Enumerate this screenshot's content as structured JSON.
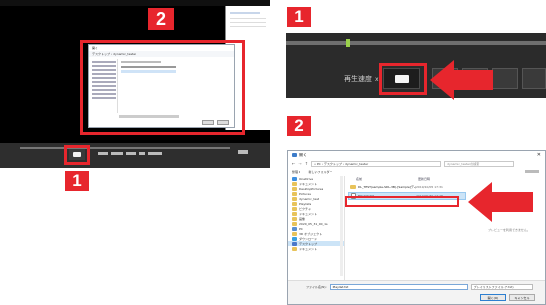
{
  "badges": {
    "left_top": "2",
    "left_bottom": "1",
    "right_top": "1",
    "right_mid": "2"
  },
  "player": {
    "window_title": "",
    "repeat_label": "再生速度",
    "repeat_value": "x1",
    "dialog_title": "開く",
    "breadcrumb": "デスクトップ › dynamic_tester"
  },
  "large_dialog": {
    "title": "開く",
    "address": "« PC › デスクトップ › dynamic_tester",
    "search_placeholder": "dynamic_testerの検索",
    "toolbar": {
      "organize": "整理 ▾",
      "new_folder": "新しいフォルダー"
    },
    "columns": {
      "name": "名前",
      "date": "更新日時"
    },
    "files": [
      {
        "name": "DL_TEST(sample-SDL-3B)-[Sample]ディレクトリ",
        "date": "2019/10/05 17:31",
        "selected": false,
        "kind": "folder"
      },
      {
        "name": "Playlist.txt",
        "date": "2019/09/30 17:28",
        "selected": true,
        "kind": "file"
      }
    ],
    "preview_text": "プレビューを利用できません。",
    "nav_items": [
      {
        "label": "OneDrive",
        "kind": "cloud"
      },
      {
        "label": "ドキュメント",
        "kind": "folder"
      },
      {
        "label": "DesktopPictures",
        "kind": "folder"
      },
      {
        "label": "Pictures",
        "kind": "folder"
      },
      {
        "label": "dynamic_test",
        "kind": "folder"
      },
      {
        "label": "Playlists",
        "kind": "folder"
      },
      {
        "label": "ピクチャ",
        "kind": "folder"
      },
      {
        "label": "ドキュメント",
        "kind": "folder"
      },
      {
        "label": "画像",
        "kind": "folder"
      },
      {
        "label": "2020_05_31_00_1s",
        "kind": "folder"
      },
      {
        "label": "PC",
        "kind": "pc"
      },
      {
        "label": "3D オブジェクト",
        "kind": "folder"
      },
      {
        "label": "ダウンロード",
        "kind": "download"
      },
      {
        "label": "デスクトップ",
        "kind": "desktop",
        "selected": true
      },
      {
        "label": "ドキュメント",
        "kind": "folder"
      }
    ],
    "filename_label": "ファイル名(N):",
    "filename_value": "Playlist.txt",
    "filetype_value": "プレイリストファイル (*.txt)",
    "open_button": "開く(O)",
    "cancel_button": "キャンセル"
  },
  "colors": {
    "accent_red": "#e7262d",
    "player_bg": "#000000",
    "control_bar": "#2e2e2e"
  }
}
